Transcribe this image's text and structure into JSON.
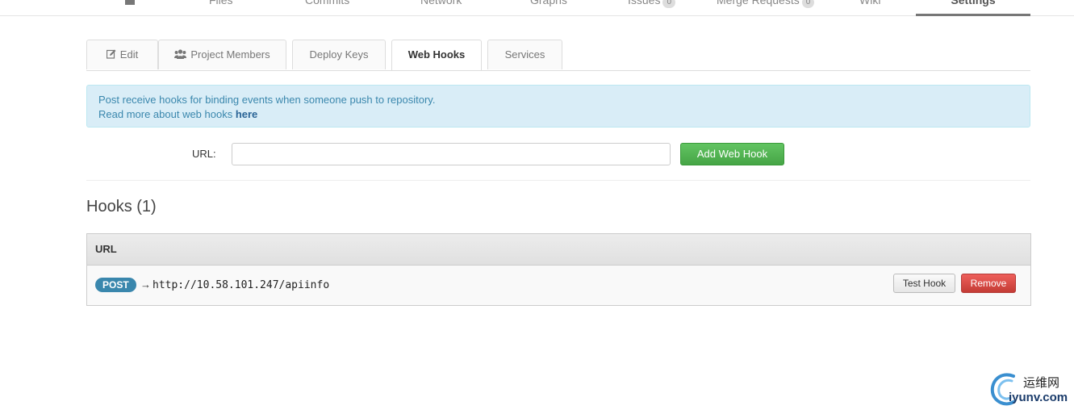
{
  "nav": {
    "items": [
      {
        "label": "Files"
      },
      {
        "label": "Commits"
      },
      {
        "label": "Network"
      },
      {
        "label": "Graphs"
      },
      {
        "label": "Issues",
        "count": "0"
      },
      {
        "label": "Merge Requests",
        "count": "0"
      },
      {
        "label": "Wiki"
      }
    ],
    "active": "Settings",
    "home_icon": "home-icon"
  },
  "tabs": [
    {
      "label": "Edit",
      "icon": "edit-icon"
    },
    {
      "label": "Project Members",
      "icon": "users-icon"
    },
    {
      "label": "Deploy Keys"
    },
    {
      "label": "Web Hooks",
      "active": true
    },
    {
      "label": "Services"
    }
  ],
  "alert": {
    "line1": "Post receive hooks for binding events when someone push to repository.",
    "line2_prefix": "Read more about web hooks ",
    "line2_link": "here"
  },
  "form": {
    "url_label": "URL:",
    "url_value": "",
    "url_placeholder": "",
    "submit_label": "Add Web Hook"
  },
  "hooks": {
    "title": "Hooks (1)",
    "column_header": "URL",
    "rows": [
      {
        "method": "POST",
        "arrow": "→",
        "url": "http://10.58.101.247/apiinfo",
        "test_label": "Test Hook",
        "remove_label": "Remove"
      }
    ]
  },
  "watermark": {
    "cn": "运维网",
    "en": "iyunv.com"
  },
  "colors": {
    "alert_bg": "#d9edf7",
    "alert_text": "#3a87ad",
    "success": "#46a546",
    "danger": "#c43c35",
    "badge": "#3a87ad"
  }
}
